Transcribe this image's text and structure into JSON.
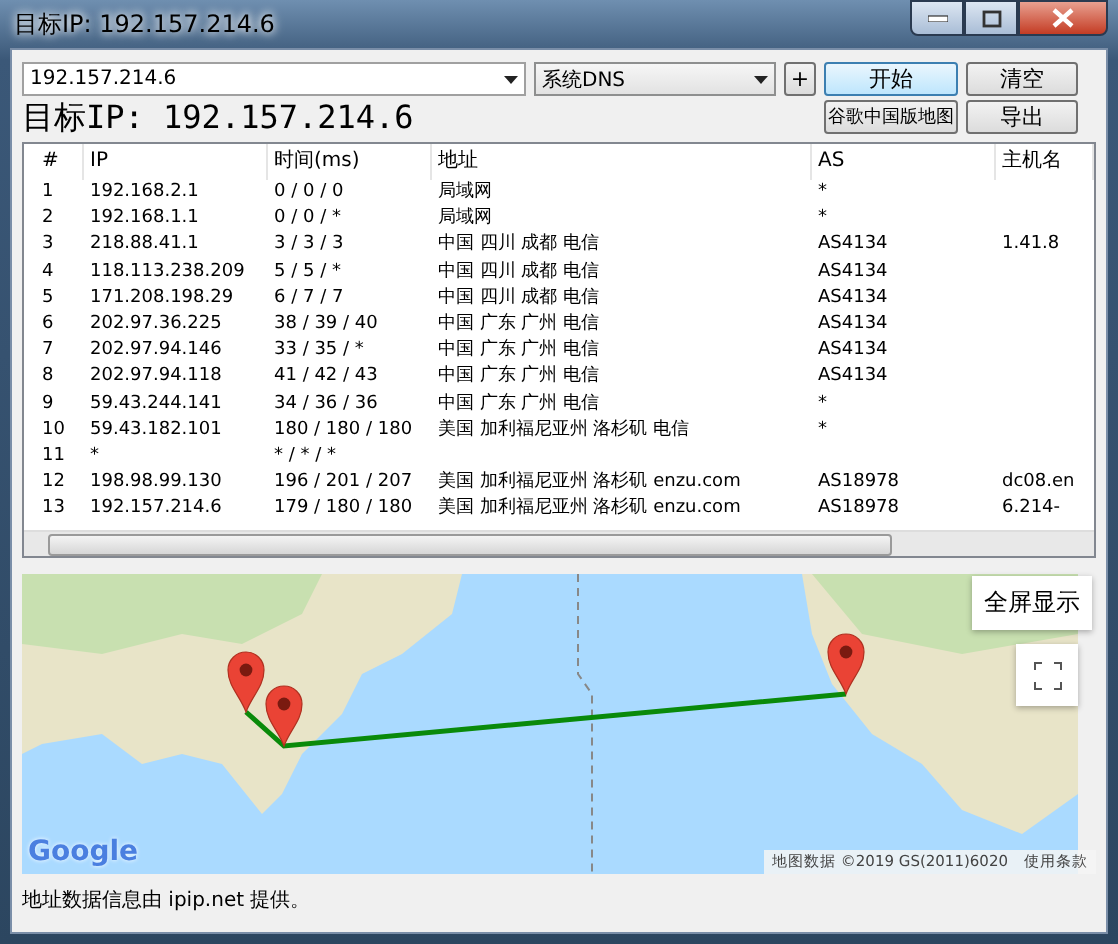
{
  "window": {
    "title": "目标IP: 192.157.214.6"
  },
  "toolbar": {
    "target_input": "192.157.214.6",
    "dns_select": "系统DNS",
    "add_button": "+",
    "start_button": "开始",
    "clear_button": "清空",
    "map_button": "谷歌中国版地图",
    "export_button": "导出"
  },
  "target_label": "目标IP: 192.157.214.6",
  "table": {
    "columns": [
      "#",
      "IP",
      "时间(ms)",
      "地址",
      "AS",
      "主机名"
    ],
    "rows": [
      {
        "num": "1",
        "ip": "192.168.2.1",
        "time": "0 / 0 / 0",
        "address": "局域网",
        "as": "*"
      },
      {
        "num": "2",
        "ip": "192.168.1.1",
        "time": "0 / 0 / *",
        "address": "局域网",
        "as": "*"
      },
      {
        "num": "3",
        "ip": "218.88.41.1",
        "time": "3 / 3 / 3",
        "address": "中国 四川 成都 电信",
        "as": "AS4134",
        "host": "1.41.8"
      },
      {
        "num": "4",
        "ip": "118.113.238.209",
        "time": "5 / 5 / *",
        "address": "中国 四川 成都 电信",
        "as": "AS4134"
      },
      {
        "num": "5",
        "ip": "171.208.198.29",
        "time": "6 / 7 / 7",
        "address": "中国 四川 成都 电信",
        "as": "AS4134"
      },
      {
        "num": "6",
        "ip": "202.97.36.225",
        "time": "38 / 39 / 40",
        "address": "中国 广东 广州 电信",
        "as": "AS4134"
      },
      {
        "num": "7",
        "ip": "202.97.94.146",
        "time": "33 / 35 / *",
        "address": "中国 广东 广州 电信",
        "as": "AS4134"
      },
      {
        "num": "8",
        "ip": "202.97.94.118",
        "time": "41 / 42 / 43",
        "address": "中国 广东 广州 电信",
        "as": "AS4134"
      },
      {
        "num": "9",
        "ip": "59.43.244.141",
        "time": "34 / 36 / 36",
        "address": "中国 广东 广州 电信",
        "as": "*"
      },
      {
        "num": "10",
        "ip": "59.43.182.101",
        "time": "180 / 180 / 180",
        "address": "美国 加利福尼亚州 洛杉矶 电信",
        "as": "*"
      },
      {
        "num": "11",
        "ip": "*",
        "time": "* / * / *"
      },
      {
        "num": "12",
        "ip": "198.98.99.130",
        "time": "196 / 201 / 207",
        "address": "美国 加利福尼亚州 洛杉矶 enzu.com",
        "as": "AS18978",
        "host": "dc08.en"
      },
      {
        "num": "13",
        "ip": "192.157.214.6",
        "time": "179 / 180 / 180",
        "address": "美国 加利福尼亚州 洛杉矶 enzu.com",
        "as": "AS18978",
        "host": "6.214-"
      }
    ]
  },
  "map": {
    "fullscreen_button": "全屏显示",
    "logo": "Google",
    "attribution": "地图数据 ©2019 GS(2011)6020",
    "terms_link": "使用条款"
  },
  "status": "地址数据信息由 ipip.net 提供。"
}
